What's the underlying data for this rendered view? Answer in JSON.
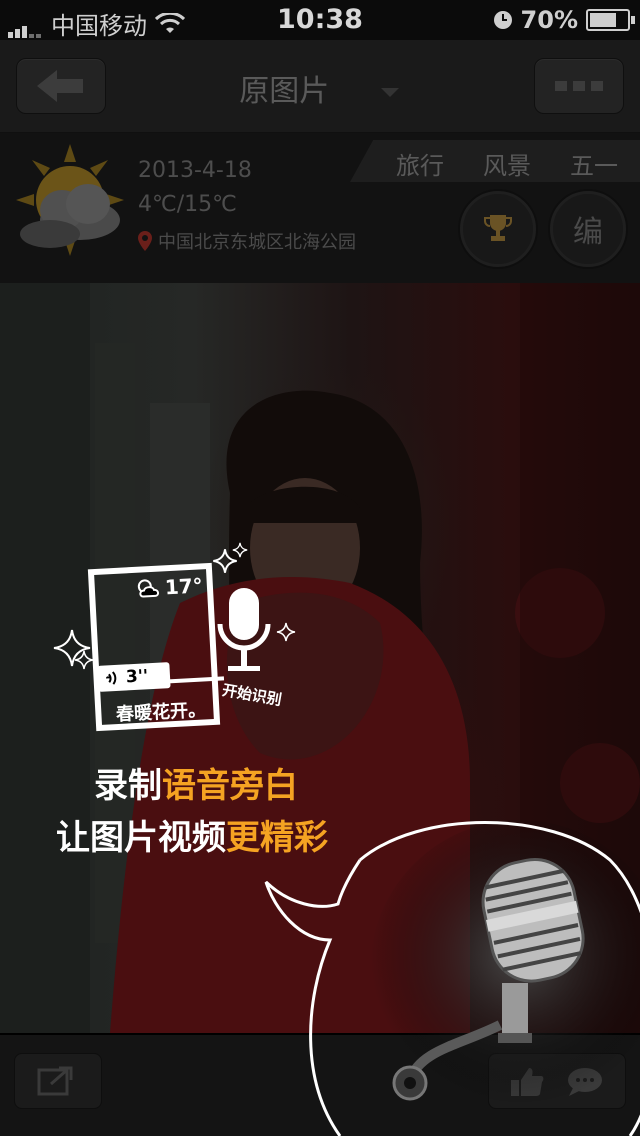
{
  "status": {
    "carrier": "中国移动",
    "time": "10:38",
    "battery": "70%"
  },
  "nav": {
    "title": "原图片"
  },
  "info": {
    "tags": [
      "旅行",
      "风景",
      "五一"
    ],
    "date": "2013-4-18",
    "temperature": "4℃/15℃",
    "location": "中国北京东城区北海公园",
    "edit_label": "编"
  },
  "tutorial": {
    "card_temp": "17°",
    "voice_length": "3''",
    "card_caption": "春暖花开。",
    "recognize_label": "开始识别",
    "line1_white": "录制",
    "line1_orange": "语音旁白",
    "line2_white": "让图片视频",
    "line2_orange": "更精彩"
  },
  "colors": {
    "accent": "#f5a322",
    "location_pin": "#c0392b",
    "trophy": "#6a5325"
  }
}
